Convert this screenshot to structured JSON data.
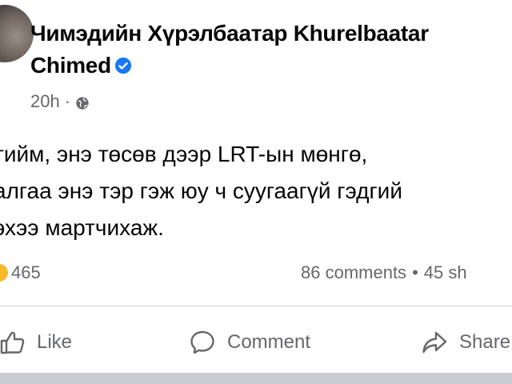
{
  "post": {
    "author": "Чимэдийн Хүрэлбаатар Khurelbaatar Chimed",
    "timestamp": "20h",
    "separator": "·",
    "privacy_icon": "globe-icon",
    "verified_icon": "verified-badge-icon",
    "text_lines": [
      "тийм, энэ төсөв дээр LRT-ын мөнгө,",
      "алгаа энэ тэр гэж юу ч суугаагүй гэдгий",
      "эхээ мартчихаж."
    ]
  },
  "stats": {
    "reaction_count": "465",
    "comments": "86 comments",
    "separator": "•",
    "shares": "45 sh"
  },
  "actions": {
    "like": "Like",
    "comment": "Comment",
    "share": "Share"
  },
  "colors": {
    "text": "#050505",
    "secondary": "#65676b",
    "verified": "#1877f2",
    "reaction": "#f7b928"
  }
}
